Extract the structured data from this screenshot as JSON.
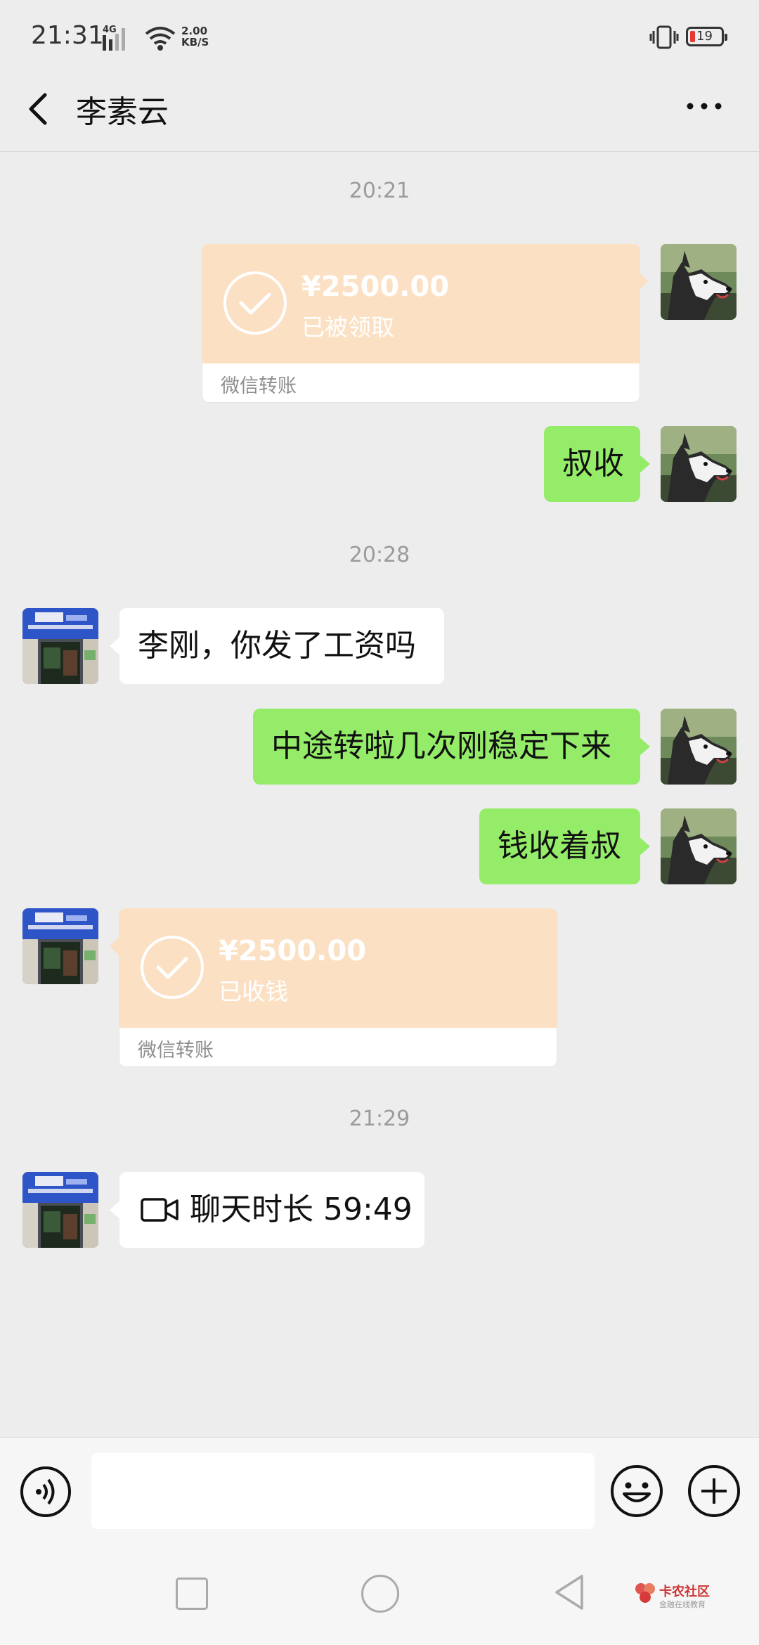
{
  "status_bar": {
    "time": "21:31",
    "network_type": "4G",
    "speed_value": "2.00",
    "speed_unit": "KB/S",
    "battery_level": "19"
  },
  "header": {
    "title": "李素云",
    "back_icon": "chevron-left-icon",
    "more_icon": "more-dots-icon"
  },
  "messages": [
    {
      "type": "timestamp",
      "text": "20:21"
    },
    {
      "type": "transfer",
      "side": "right",
      "amount": "¥2500.00",
      "status": "已被领取",
      "footer": "微信转账"
    },
    {
      "type": "text",
      "side": "right",
      "text": "叔收"
    },
    {
      "type": "timestamp",
      "text": "20:28"
    },
    {
      "type": "text",
      "side": "left",
      "text": "李刚，你发了工资吗"
    },
    {
      "type": "text",
      "side": "right",
      "text": "中途转啦几次刚稳定下来"
    },
    {
      "type": "text",
      "side": "right",
      "text": "钱收着叔"
    },
    {
      "type": "transfer",
      "side": "left",
      "amount": "¥2500.00",
      "status": "已收钱",
      "footer": "微信转账"
    },
    {
      "type": "timestamp",
      "text": "21:29"
    },
    {
      "type": "video_call",
      "side": "left",
      "text": "聊天时长 59:49"
    }
  ],
  "input_bar": {
    "voice_icon": "voice-icon",
    "input_value": "",
    "emoji_icon": "emoji-icon",
    "plus_icon": "plus-icon"
  },
  "watermark": {
    "title": "卡农社区",
    "subtitle": "金融在线教育"
  },
  "colors": {
    "background": "#ededed",
    "sent_bubble": "#95ec69",
    "received_bubble": "#ffffff",
    "transfer_orange": "#fce0c4"
  }
}
